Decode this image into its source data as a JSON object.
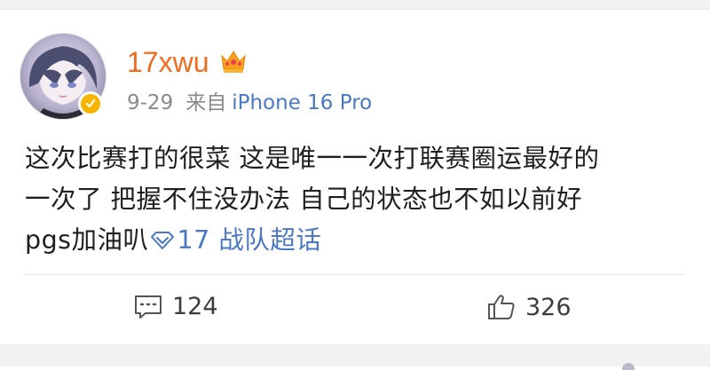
{
  "post": {
    "author": "17xwu",
    "date": "9-29",
    "from_label": "来自",
    "device": "iPhone 16 Pro",
    "lines": [
      "这次比赛打的很菜 这是唯一一次打联赛圈运最好的",
      "一次了 把握不住没办法 自己的状态也不如以前好",
      "pgs加油叭"
    ],
    "topic": "17 战队超话"
  },
  "actions": {
    "comments": "124",
    "likes": "326"
  },
  "colors": {
    "username": "#f26b1d",
    "link": "#4a78c5",
    "meta": "#8a8a8a",
    "verified_badge": "#f7b500"
  },
  "icons": {
    "verified": "verified-badge-icon",
    "crown": "crown-icon",
    "topic": "diamond-icon",
    "comment": "comment-icon",
    "like": "thumbs-up-icon"
  }
}
